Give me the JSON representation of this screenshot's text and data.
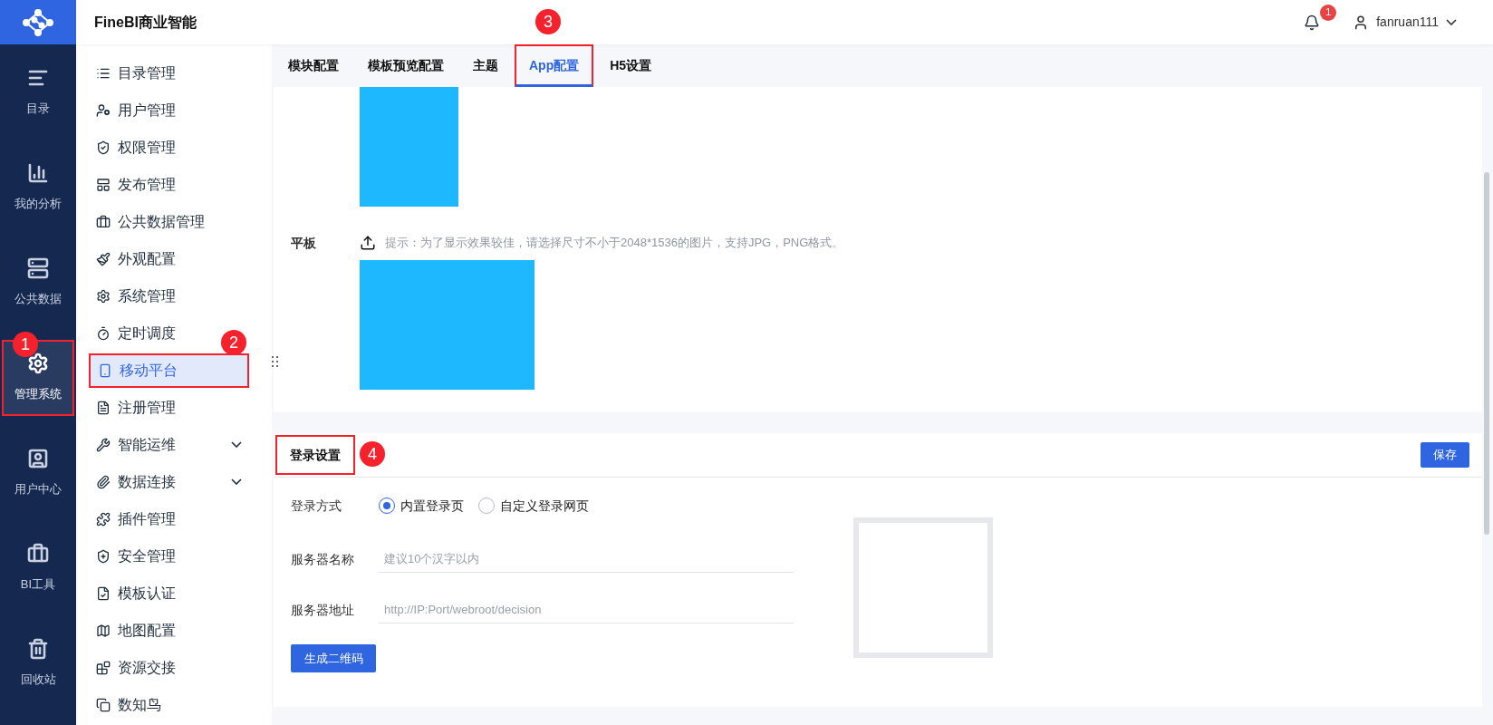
{
  "app_title": "FineBI商业智能",
  "header": {
    "notifications": "1",
    "user": "fanruan111"
  },
  "rail": [
    {
      "label": "目录",
      "selected": false
    },
    {
      "label": "我的分析",
      "selected": false
    },
    {
      "label": "公共数据",
      "selected": false
    },
    {
      "label": "管理系统",
      "selected": true,
      "outlined": true,
      "callout": "1"
    },
    {
      "label": "用户中心",
      "selected": false
    },
    {
      "label": "BI工具",
      "selected": false
    },
    {
      "label": "回收站",
      "selected": false
    }
  ],
  "menu": [
    {
      "label": "目录管理",
      "selected": false
    },
    {
      "label": "用户管理",
      "selected": false
    },
    {
      "label": "权限管理",
      "selected": false
    },
    {
      "label": "发布管理",
      "selected": false
    },
    {
      "label": "公共数据管理",
      "selected": false
    },
    {
      "label": "外观配置",
      "selected": false
    },
    {
      "label": "系统管理",
      "selected": false
    },
    {
      "label": "定时调度",
      "selected": false
    },
    {
      "label": "移动平台",
      "selected": true,
      "outlined": true,
      "callout": "2"
    },
    {
      "label": "注册管理",
      "selected": false
    },
    {
      "label": "智能运维",
      "selected": false,
      "expanded": false
    },
    {
      "label": "数据连接",
      "selected": false,
      "expanded": false
    },
    {
      "label": "插件管理",
      "selected": false
    },
    {
      "label": "安全管理",
      "selected": false
    },
    {
      "label": "模板认证",
      "selected": false
    },
    {
      "label": "地图配置",
      "selected": false
    },
    {
      "label": "资源交接",
      "selected": false
    },
    {
      "label": "数知鸟",
      "selected": false
    }
  ],
  "tabs": [
    {
      "label": "模块配置",
      "selected": false
    },
    {
      "label": "模板预览配置",
      "selected": false
    },
    {
      "label": "主题",
      "selected": false
    },
    {
      "label": "App配置",
      "selected": true,
      "outlined": true,
      "callout": "3"
    },
    {
      "label": "H5设置",
      "selected": false
    }
  ],
  "tablet": {
    "label": "平板",
    "hint": "提示：为了显示效果较佳，请选择尺寸不小于2048*1536的图片，支持JPG，PNG格式。"
  },
  "login": {
    "title": "登录设置",
    "outlined": true,
    "callout": "4",
    "save": "保存",
    "method_label": "登录方式",
    "methods": [
      {
        "label": "内置登录页",
        "selected": true
      },
      {
        "label": "自定义登录网页",
        "selected": false
      }
    ],
    "fields": [
      {
        "label": "服务器名称",
        "placeholder": "建议10个汉字以内"
      },
      {
        "label": "服务器地址",
        "placeholder": "http://IP:Port/webroot/decision"
      }
    ],
    "generate": "生成二维码"
  }
}
